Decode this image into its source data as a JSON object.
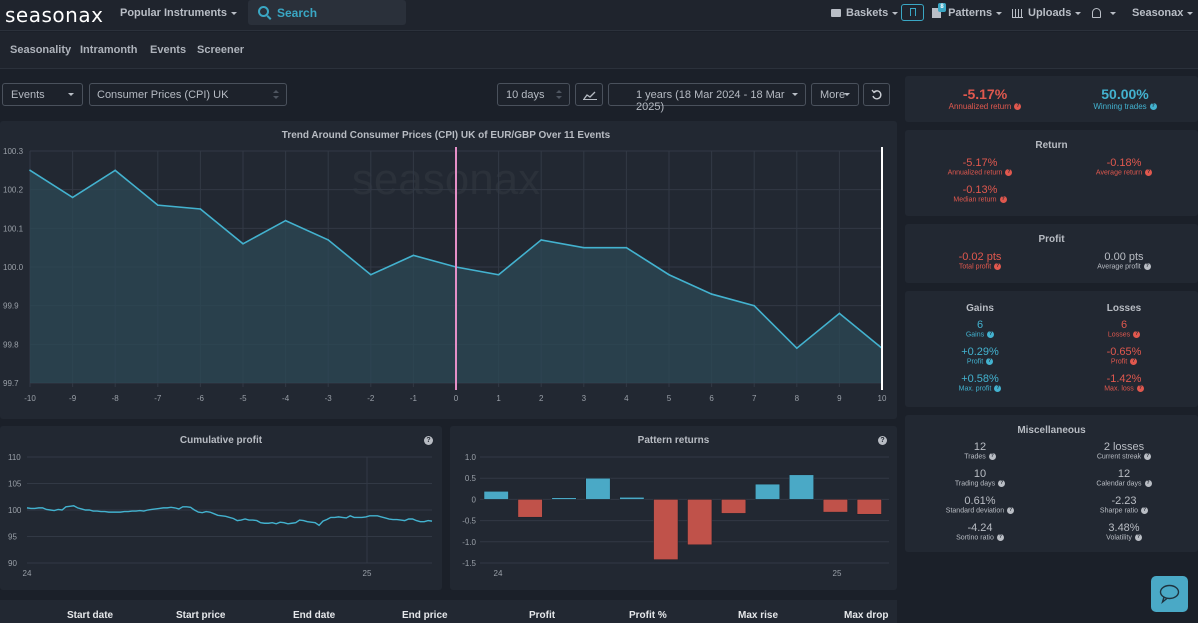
{
  "header": {
    "logo": "seasonax",
    "popular_instruments": "Popular Instruments",
    "search_label": "Search",
    "baskets": "Baskets",
    "patterns": "Patterns",
    "patterns_badge": "8",
    "uploads": "Uploads",
    "account": "Seasonax"
  },
  "subnav": [
    "Seasonality",
    "Intramonth",
    "Events",
    "Screener"
  ],
  "controls": {
    "mode": "Events",
    "event": "Consumer Prices (CPI) UK",
    "window": "10 days",
    "range": "1 years (18 Mar 2024 - 18 Mar 2025)",
    "more": "More"
  },
  "summary": {
    "annualized_return": "-5.17%",
    "annualized_return_label": "Annualized return",
    "winning_trades": "50.00%",
    "winning_trades_label": "Winning trades"
  },
  "return_section": {
    "title": "Return",
    "annualized": {
      "value": "-5.17%",
      "label": "Annualized return"
    },
    "average": {
      "value": "-0.18%",
      "label": "Average return"
    },
    "median": {
      "value": "-0.13%",
      "label": "Median return"
    }
  },
  "profit_section": {
    "title": "Profit",
    "total": {
      "value": "-0.02 pts",
      "label": "Total profit"
    },
    "average": {
      "value": "0.00 pts",
      "label": "Average profit"
    }
  },
  "gains_losses": {
    "gains_title": "Gains",
    "losses_title": "Losses",
    "gains": [
      {
        "value": "6",
        "label": "Gains"
      },
      {
        "value": "+0.29%",
        "label": "Profit"
      },
      {
        "value": "+0.58%",
        "label": "Max. profit"
      }
    ],
    "losses": [
      {
        "value": "6",
        "label": "Losses"
      },
      {
        "value": "-0.65%",
        "label": "Profit"
      },
      {
        "value": "-1.42%",
        "label": "Max. loss"
      }
    ]
  },
  "misc": {
    "title": "Miscellaneous",
    "items": [
      {
        "value": "12",
        "label": "Trades"
      },
      {
        "value": "2 losses",
        "label": "Current streak"
      },
      {
        "value": "10",
        "label": "Trading days"
      },
      {
        "value": "12",
        "label": "Calendar days"
      },
      {
        "value": "0.61%",
        "label": "Standard deviation"
      },
      {
        "value": "-2.23",
        "label": "Sharpe ratio"
      },
      {
        "value": "-4.24",
        "label": "Sortino ratio"
      },
      {
        "value": "3.48%",
        "label": "Volatility"
      }
    ]
  },
  "table": {
    "columns": [
      "Start date",
      "Start price",
      "End date",
      "End price",
      "Profit",
      "Profit %",
      "Max rise",
      "Max drop"
    ]
  },
  "chart_data": [
    {
      "type": "area",
      "title": "Trend Around Consumer Prices (CPI) UK of EUR/GBP Over 11 Events",
      "watermark": "seasonax",
      "x": [
        -10,
        -9,
        -8,
        -7,
        -6,
        -5,
        -4,
        -3,
        -2,
        -1,
        0,
        1,
        2,
        3,
        4,
        5,
        6,
        7,
        8,
        9,
        10
      ],
      "values": [
        100.25,
        100.18,
        100.25,
        100.16,
        100.15,
        100.06,
        100.12,
        100.07,
        99.98,
        100.03,
        100.0,
        99.98,
        100.07,
        100.05,
        100.05,
        99.98,
        99.93,
        99.9,
        99.79,
        99.88,
        99.79
      ],
      "ylim": [
        99.7,
        100.3
      ],
      "yticks": [
        "100.3",
        "100.2",
        "100.1",
        "100.0",
        "99.9",
        "99.8",
        "99.7"
      ],
      "xticks": [
        "-10",
        "-9",
        "-8",
        "-7",
        "-6",
        "-5",
        "-4",
        "-3",
        "-2",
        "-1",
        "0",
        "1",
        "2",
        "3",
        "4",
        "5",
        "6",
        "7",
        "8",
        "9",
        "10"
      ],
      "event_marker_x": 0,
      "end_marker_x": 10,
      "grid": true,
      "line_color": "#43b2cf",
      "marker_color": "#e58fc7"
    },
    {
      "type": "line",
      "title": "Cumulative profit",
      "ylim": [
        90,
        110
      ],
      "yticks": [
        "110",
        "105",
        "100",
        "95",
        "90"
      ],
      "xticks": [
        "24",
        "25"
      ],
      "values": [
        100.4,
        100.3,
        100.3,
        100.4,
        100.4,
        100.1,
        100.0,
        99.9,
        100.1,
        100.0,
        100.6,
        100.7,
        100.8,
        100.4,
        100.2,
        100.0,
        100.0,
        99.8,
        99.8,
        99.7,
        99.7,
        99.6,
        99.6,
        99.6,
        99.6,
        99.7,
        99.7,
        99.8,
        99.8,
        99.9,
        99.8,
        100.0,
        100.1,
        100.2,
        100.3,
        100.4,
        100.4,
        100.5,
        100.4,
        100.2,
        100.6,
        100.6,
        100.5,
        100.0,
        99.6,
        99.5,
        99.7,
        99.6,
        99.3,
        99.0,
        98.9,
        98.8,
        98.6,
        98.4,
        98.0,
        98.1,
        98.3,
        98.1,
        98.1,
        98.0,
        97.6,
        97.5,
        97.5,
        97.6,
        97.4,
        97.7,
        97.6,
        97.4,
        97.5,
        97.6,
        98.1,
        98.0,
        97.8,
        97.7,
        97.6,
        97.1,
        97.9,
        98.2,
        98.6,
        98.6,
        98.7,
        98.6,
        98.5,
        98.9,
        98.6,
        98.6,
        98.6,
        98.7,
        98.9,
        98.9,
        98.9,
        98.7,
        98.5,
        98.3,
        98.2,
        98.2,
        98.1,
        98.0,
        98.3,
        98.3,
        98.0,
        97.8,
        97.8,
        98.0,
        97.9
      ],
      "line_color": "#43b2cf"
    },
    {
      "type": "bar",
      "title": "Pattern returns",
      "ylim": [
        -1.5,
        1.0
      ],
      "yticks": [
        "1.0",
        "0.5",
        "0",
        "-0.5",
        "-1.0",
        "-1.5"
      ],
      "xticks": [
        "24",
        "25"
      ],
      "values": [
        0.19,
        -0.42,
        0.04,
        0.5,
        0.05,
        -1.42,
        -1.07,
        -0.33,
        0.36,
        0.58,
        -0.3,
        -0.35
      ],
      "positive_color": "#4aa9c6",
      "negative_color": "#c0524a"
    }
  ]
}
